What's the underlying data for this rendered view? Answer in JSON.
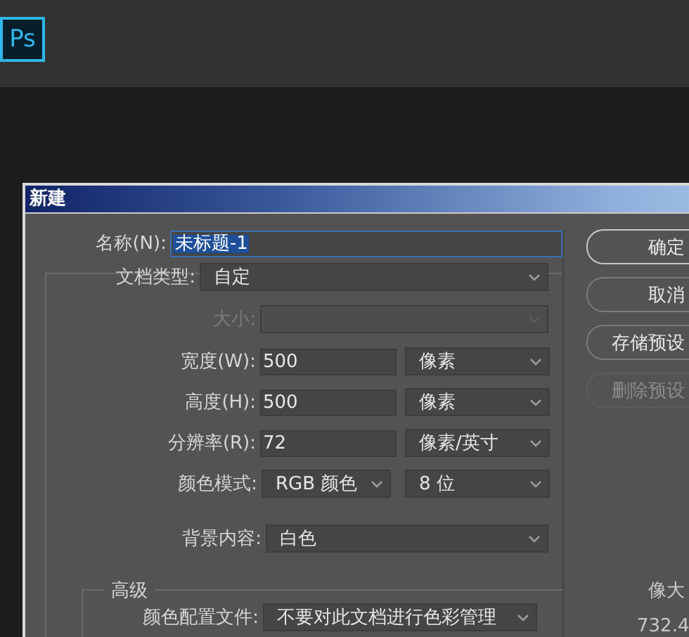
{
  "app": {
    "logo": "Ps"
  },
  "dialog": {
    "title": "新建",
    "name_field": {
      "label": "名称(N):",
      "value": "未标题-1",
      "focused": true
    },
    "fields": [
      {
        "kind": "preset",
        "label": "文档类型:",
        "value": "自定",
        "disabled": false
      },
      {
        "kind": "size",
        "label": "大小:",
        "disabled": true
      },
      {
        "kind": "measure",
        "label": "宽度(W):",
        "value": "500",
        "unit": "像素",
        "disabled": false
      },
      {
        "kind": "measure",
        "label": "高度(H):",
        "value": "500",
        "unit": "像素",
        "disabled": false
      },
      {
        "kind": "measure",
        "label": "分辨率(R):",
        "value": "72",
        "unit": "像素/英寸",
        "disabled": false
      },
      {
        "kind": "mode",
        "label": "颜色模式:",
        "value": "RGB 颜色",
        "unit": "8 位",
        "disabled": false
      },
      {
        "kind": "background",
        "label": "背景内容:",
        "value": "白色",
        "disabled": false
      }
    ],
    "advanced": {
      "title": "高级",
      "fields": [
        {
          "label": "颜色配置文件:",
          "value": "不要对此文档进行色彩管理"
        }
      ]
    },
    "buttons": [
      {
        "label": "确定",
        "default": true,
        "disabled": false
      },
      {
        "label": "取消",
        "default": false,
        "disabled": false
      },
      {
        "label": "存储预设",
        "default": false,
        "disabled": false
      },
      {
        "label": "删除预设",
        "default": false,
        "disabled": true
      }
    ],
    "size_info": {
      "label": "像大",
      "value": "732.4"
    }
  }
}
